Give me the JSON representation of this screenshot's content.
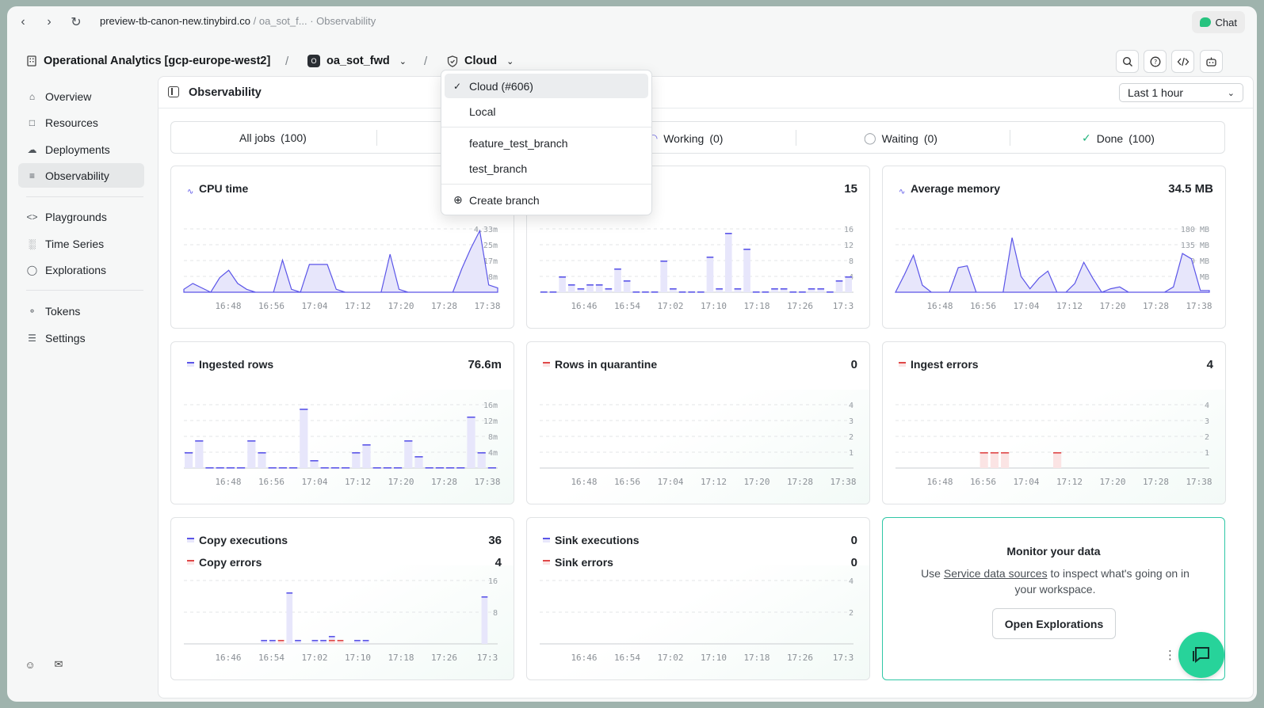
{
  "browser": {
    "url_host": "preview-tb-canon-new.tinybird.co",
    "url_path": " / oa_sot_f...",
    "url_page": " · Observability",
    "chat_label": "Chat"
  },
  "header": {
    "workspace": "Operational Analytics [gcp-europe-west2]",
    "ws_initial": "O",
    "project": "oa_sot_fwd",
    "environment": "Cloud",
    "separator": "/"
  },
  "sidebar": {
    "items": [
      {
        "label": "Overview",
        "icon": "home-icon"
      },
      {
        "label": "Resources",
        "icon": "file-icon"
      },
      {
        "label": "Deployments",
        "icon": "cloud-upload-icon"
      },
      {
        "label": "Observability",
        "icon": "list-icon"
      },
      {
        "label": "Playgrounds",
        "icon": "code-icon"
      },
      {
        "label": "Time Series",
        "icon": "bar-chart-icon"
      },
      {
        "label": "Explorations",
        "icon": "chat-icon"
      },
      {
        "label": "Tokens",
        "icon": "key-icon"
      },
      {
        "label": "Settings",
        "icon": "sliders-icon"
      }
    ]
  },
  "page": {
    "title": "Observability",
    "time_range": "Last 1 hour"
  },
  "jobs": [
    {
      "label": "All jobs",
      "count": "(100)"
    },
    {
      "label": "Working",
      "count": "(0)"
    },
    {
      "label": "Waiting",
      "count": "(0)"
    },
    {
      "label": "Done",
      "count": "(100)"
    }
  ],
  "dropdown": {
    "items": [
      "Cloud (#606)",
      "Local",
      "feature_test_branch",
      "test_branch"
    ],
    "create": "Create branch"
  },
  "cards": {
    "cpu": {
      "title": "CPU time",
      "value": ""
    },
    "requests": {
      "title": "",
      "value": "15"
    },
    "memory": {
      "title": "Average memory",
      "value": "34.5 MB"
    },
    "ingested": {
      "title": "Ingested rows",
      "value": "76.6m"
    },
    "quarantine": {
      "title": "Rows in quarantine",
      "value": "0"
    },
    "ingest_errors": {
      "title": "Ingest errors",
      "value": "4"
    },
    "copy": {
      "title": "Copy executions",
      "value": "36",
      "title2": "Copy errors",
      "value2": "4"
    },
    "sink": {
      "title": "Sink executions",
      "value": "0",
      "title2": "Sink errors",
      "value2": "0"
    }
  },
  "cta": {
    "title": "Monitor your data",
    "text_before": "Use ",
    "link": "Service data sources",
    "text_after": " to inspect what's going on in your workspace.",
    "button": "Open Explorations"
  },
  "chart_data": [
    {
      "type": "area",
      "title": "CPU time",
      "x_ticks": [
        "16:48",
        "16:56",
        "17:04",
        "17:12",
        "17:20",
        "17:28",
        "17:38"
      ],
      "y_ticks": [
        "1.08m",
        "2.17m",
        "3.25m",
        "4.33m"
      ],
      "values": [
        0.2,
        0.6,
        0.3,
        0,
        1.0,
        1.5,
        0.6,
        0.2,
        0,
        0,
        0,
        2.2,
        0.2,
        0,
        1.9,
        1.9,
        1.9,
        0.2,
        0,
        0,
        0,
        0,
        0,
        2.6,
        0.2,
        0,
        0,
        0,
        0,
        0,
        0,
        1.6,
        3.0,
        4.2,
        0.5,
        0.3
      ]
    },
    {
      "type": "bar",
      "title": "",
      "x_ticks": [
        "16:46",
        "16:54",
        "17:02",
        "17:10",
        "17:18",
        "17:26",
        "17:3"
      ],
      "y_ticks": [
        "4",
        "8",
        "12",
        "16"
      ],
      "values": [
        0,
        0,
        4,
        2,
        1,
        2,
        2,
        1,
        6,
        3,
        0,
        0,
        0,
        8,
        1,
        0,
        0,
        0,
        9,
        1,
        15,
        1,
        11,
        0,
        0,
        1,
        1,
        0,
        0,
        1,
        1,
        0,
        3,
        4
      ]
    },
    {
      "type": "area",
      "title": "Average memory",
      "x_ticks": [
        "16:48",
        "16:56",
        "17:04",
        "17:12",
        "17:20",
        "17:28",
        "17:38"
      ],
      "y_ticks": [
        "45 MB",
        "90 MB",
        "135 MB",
        "180 MB"
      ],
      "values": [
        0,
        50,
        105,
        20,
        0,
        0,
        0,
        70,
        75,
        0,
        0,
        0,
        0,
        155,
        45,
        10,
        40,
        60,
        0,
        0,
        25,
        85,
        40,
        0,
        10,
        15,
        0,
        0,
        0,
        0,
        0,
        15,
        110,
        95,
        5,
        5
      ]
    },
    {
      "type": "bar",
      "title": "Ingested rows",
      "x_ticks": [
        "16:48",
        "16:56",
        "17:04",
        "17:12",
        "17:20",
        "17:28",
        "17:38"
      ],
      "y_ticks": [
        "4m",
        "8m",
        "12m",
        "16m"
      ],
      "values": [
        4,
        7,
        0,
        0,
        0,
        0,
        7,
        4,
        0,
        0,
        0,
        15,
        2,
        0,
        0,
        0,
        4,
        6,
        0,
        0,
        0,
        7,
        3,
        0,
        0,
        0,
        0,
        13,
        4,
        0
      ]
    },
    {
      "type": "bar",
      "title": "Rows in quarantine",
      "x_ticks": [
        "16:48",
        "16:56",
        "17:04",
        "17:12",
        "17:20",
        "17:28",
        "17:38"
      ],
      "y_ticks": [
        "1",
        "2",
        "3",
        "4"
      ],
      "values": []
    },
    {
      "type": "bar",
      "title": "Ingest errors",
      "x_ticks": [
        "16:48",
        "16:56",
        "17:04",
        "17:12",
        "17:20",
        "17:28",
        "17:38"
      ],
      "y_ticks": [
        "1",
        "2",
        "3",
        "4"
      ],
      "values": [
        0,
        0,
        0,
        0,
        0,
        0,
        0,
        0,
        1,
        1,
        1,
        0,
        0,
        0,
        0,
        1,
        0,
        0,
        0,
        0,
        0,
        0,
        0,
        0,
        0,
        0,
        0,
        0,
        0,
        0
      ]
    },
    {
      "type": "bar",
      "title": "Copy executions",
      "x_ticks": [
        "16:46",
        "16:54",
        "17:02",
        "17:10",
        "17:18",
        "17:26",
        "17:3"
      ],
      "y_ticks": [
        "8",
        "16"
      ],
      "series": [
        {
          "name": "Copy executions",
          "values": [
            0,
            0,
            0,
            0,
            0,
            0,
            0,
            0,
            0,
            1,
            1,
            0,
            13,
            1,
            0,
            1,
            1,
            2,
            1,
            0,
            1,
            1,
            0,
            0,
            0,
            0,
            0,
            0,
            0,
            0,
            0,
            0,
            0,
            0,
            0,
            12,
            0
          ]
        },
        {
          "name": "Copy errors",
          "values": [
            0,
            0,
            0,
            0,
            0,
            0,
            0,
            0,
            0,
            0,
            0,
            1,
            0,
            0,
            0,
            0,
            0,
            1,
            1,
            0,
            0,
            0,
            0,
            0,
            0,
            0,
            0,
            0,
            0,
            0,
            0,
            0,
            0,
            0,
            0,
            0,
            0
          ]
        }
      ]
    },
    {
      "type": "bar",
      "title": "Sink executions",
      "x_ticks": [
        "16:46",
        "16:54",
        "17:02",
        "17:10",
        "17:18",
        "17:26",
        "17:3"
      ],
      "y_ticks": [
        "2",
        "4"
      ],
      "values": []
    }
  ]
}
